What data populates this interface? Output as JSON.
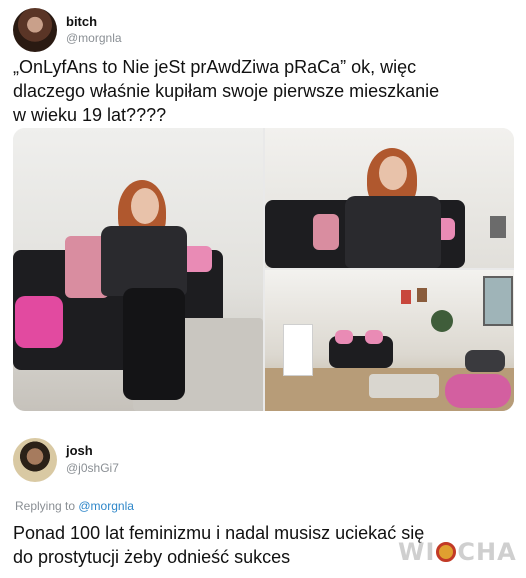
{
  "tweet": {
    "name": "bitch",
    "handle": "@morgnla",
    "text": "„OnLyfAns to Nie jeSt prAwdZiwa pRaCa” ok, więc\ndlaczego właśnie kupiłam swoje pierwsze mieszkanie\nw wieku 19 lat????"
  },
  "photos": {
    "items": [
      {
        "name": "woman-on-sofa-photo"
      },
      {
        "name": "woman-close-up-photo"
      },
      {
        "name": "living-room-photo"
      }
    ]
  },
  "reply": {
    "name": "josh",
    "handle": "@j0shGi7",
    "replying_prefix": "Replying to ",
    "replying_handle": "@morgnla",
    "text": "Ponad 100 lat feminizmu i nadal musisz uciekać się\ndo prostytucji żeby odnieść sukces"
  },
  "watermark": {
    "left": "WI",
    "right": "CHA"
  },
  "colors": {
    "link": "#2f87c9",
    "muted": "#8a8f94",
    "accent_pink": "#e24aa0"
  }
}
